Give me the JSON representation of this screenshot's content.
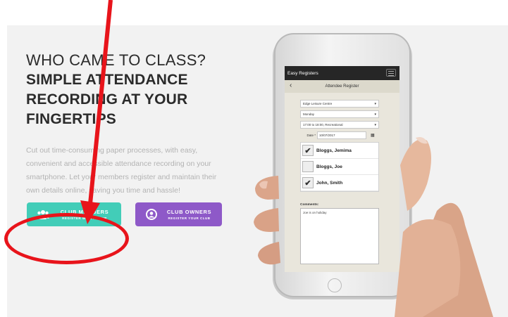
{
  "hero": {
    "headline_light": "WHO CAME TO CLASS?",
    "headline_bold": [
      "SIMPLE ATTENDANCE",
      "RECORDING AT YOUR",
      "FINGERTIPS"
    ],
    "description": "Cut out time-consuming paper processes, with easy, convenient and accessible attendance recording on your smartphone. Let your members register and maintain their own details online, saving you time and hassle!"
  },
  "buttons": {
    "members": {
      "label": "CLUB MEMBERS",
      "sublabel": "REGISTER WITH A CLUB",
      "icon": "group-icon",
      "color": "#42cdb8"
    },
    "owners": {
      "label": "CLUB OWNERS",
      "sublabel": "REGISTER YOUR CLUB",
      "icon": "user-circle-icon",
      "color": "#8e59c8"
    }
  },
  "annotation": {
    "color": "#e8141b"
  },
  "phone_app": {
    "app_title": "Easy Registers",
    "page_title": "Attendee Register",
    "back_icon": "back-arrow-icon",
    "menu_icon": "hamburger-icon",
    "venue": "Edge Leisure Centre",
    "day": "Monday",
    "class": "17:00 to 18:00, Recreational",
    "date_label": "Date *",
    "date_value": "10/07/2017",
    "attendees": [
      {
        "name": "Bloggs, Jemima",
        "checked": true
      },
      {
        "name": "Bloggs, Joe",
        "checked": false
      },
      {
        "name": "John, Smith",
        "checked": true
      }
    ],
    "comments_label": "Comments:",
    "comments_value": "Joe is on holiday"
  }
}
